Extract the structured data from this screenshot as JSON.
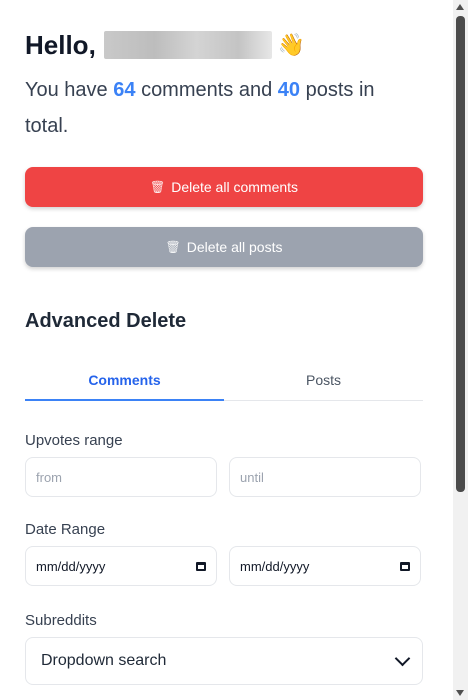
{
  "greeting": {
    "hello": "Hello,",
    "username_redacted": true,
    "wave_emoji": "👋"
  },
  "summary": {
    "prefix": "You have",
    "comments_count": "64",
    "middle": "comments and",
    "posts_count": "40",
    "suffix": "posts in total."
  },
  "actions": {
    "delete_comments_label": "Delete all comments",
    "delete_posts_label": "Delete all posts",
    "delete_comments_color": "#ef4444",
    "delete_posts_color": "#9ca3af",
    "trash_icon": "🗑"
  },
  "advanced": {
    "title": "Advanced Delete",
    "tabs": [
      {
        "label": "Comments",
        "active": true
      },
      {
        "label": "Posts",
        "active": false
      }
    ],
    "upvotes": {
      "label": "Upvotes range",
      "from_placeholder": "from",
      "until_placeholder": "until"
    },
    "date_range": {
      "label": "Date Range",
      "start_value": "mm/dd/yyyy",
      "end_value": "mm/dd/yyyy"
    },
    "subreddits": {
      "label": "Subreddits",
      "selected": "Dropdown search"
    }
  },
  "colors": {
    "accent": "#3b82f6",
    "danger": "#ef4444",
    "muted": "#9ca3af"
  }
}
